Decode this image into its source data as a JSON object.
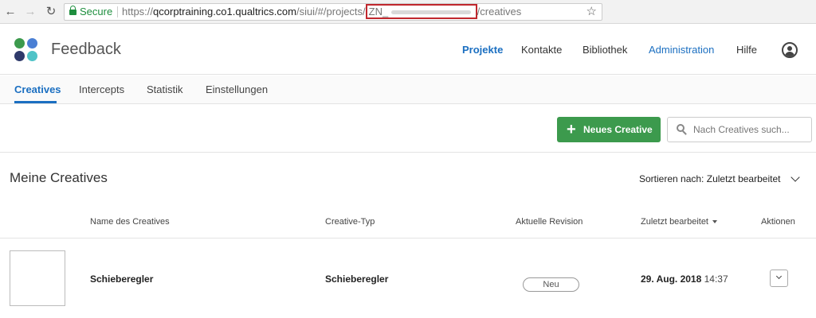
{
  "browser": {
    "secure_label": "Secure",
    "url_prefix": "https://",
    "url_host": "qcorptraining.co1.qualtrics.com",
    "url_path": "/siui/#/projects/",
    "url_redacted_prefix": "ZN_",
    "url_suffix": "/creatives"
  },
  "app": {
    "title": "Feedback",
    "logo_colors": [
      "#3c9a4d",
      "#4a7fd4",
      "#2f3a6b",
      "#4fc3c7"
    ]
  },
  "top_nav": {
    "items": [
      "Projekte",
      "Kontakte",
      "Bibliothek",
      "Administration",
      "Hilfe"
    ],
    "active": "Projekte",
    "user_icon": "user-icon"
  },
  "sub_tabs": {
    "items": [
      "Creatives",
      "Intercepts",
      "Statistik",
      "Einstellungen"
    ],
    "active": "Creatives"
  },
  "toolbar": {
    "new_button_label": "Neues Creative",
    "search_placeholder": "Nach Creatives such..."
  },
  "section": {
    "title": "Meine Creatives",
    "sort_label": "Sortieren nach:",
    "sort_value": "Zuletzt bearbeitet"
  },
  "table": {
    "columns": [
      "Name des Creatives",
      "Creative-Typ",
      "Aktuelle Revision",
      "Zuletzt bearbeitet",
      "Aktionen"
    ],
    "rows": [
      {
        "name": "Schieberegler",
        "type": "Schieberegler",
        "revision": "Neu",
        "edited_date": "29. Aug. 2018",
        "edited_time": "14:37"
      }
    ]
  },
  "colors": {
    "accent": "#1b6fc1",
    "primary_button": "#3c9a4d",
    "secure_green": "#1e8e3e",
    "redaction_border": "#c0272d"
  }
}
